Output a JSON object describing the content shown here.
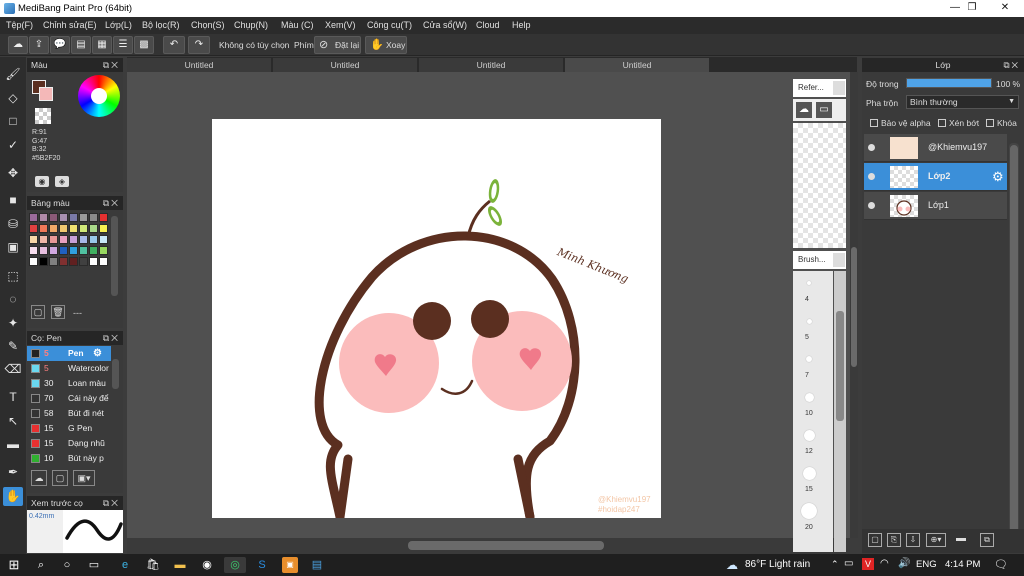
{
  "window": {
    "title": "MediBang Paint Pro (64bit)",
    "minimize": "—",
    "maximize": "❐",
    "close": "✕"
  },
  "menu": [
    "Tệp(F)",
    "Chỉnh sửa(E)",
    "Lớp(L)",
    "Bộ lọc(R)",
    "Chọn(S)",
    "Chụp(N)",
    "Màu (C)",
    "Xem(V)",
    "Công cụ(T)",
    "Cửa sổ(W)",
    "Cloud",
    "Help"
  ],
  "toolbar": {
    "option_label": "Không có tùy chọn",
    "key_label": "Phím",
    "reset_label": "Đặt lại",
    "rotate_label": "Xoay"
  },
  "tabs": [
    "Untitled",
    "Untitled",
    "Untitled",
    "Untitled"
  ],
  "color_panel": {
    "title": "Màu",
    "r": "R:91",
    "g": "G:47",
    "b": "B:32",
    "hex": "#5B2F20",
    "primary_color": "#5b2f20",
    "secondary_color": "#f4b8b8"
  },
  "palette_panel": {
    "title": "Bảng màu",
    "footer": "---",
    "swatches": [
      "#9b6b9b",
      "#b08aa8",
      "#8b5a78",
      "#a890b0",
      "#7a7aa8",
      "#9a9a9a",
      "#8a8a8a",
      "#e53030",
      "#e04040",
      "#f07858",
      "#f0a868",
      "#f0c870",
      "#f0e070",
      "#d0e878",
      "#a8d888",
      "#f8f050",
      "#f8d8a8",
      "#f0b8a8",
      "#e89898",
      "#e8a0c0",
      "#c8a0d8",
      "#a8b8e8",
      "#98c8e8",
      "#c8e8f8",
      "#f8e0f0",
      "#e8c0e0",
      "#d0a8e0",
      "#2060c0",
      "#30a0e0",
      "#50c0a0",
      "#40b060",
      "#98d860",
      "#ffffff",
      "#000000",
      "#808080",
      "#803030",
      "#602020",
      "#404040",
      "#ffffff",
      "#ffffff"
    ]
  },
  "brush_panel": {
    "title": "Cọ: Pen",
    "brushes": [
      {
        "size": "5",
        "name": "Pen",
        "color": "#222222"
      },
      {
        "size": "5",
        "name": "Watercolor",
        "color": "#6ad8f0"
      },
      {
        "size": "30",
        "name": "Loan màu",
        "color": "#6ad8f0"
      },
      {
        "size": "70",
        "name": "Cái này để",
        "color": "#333333"
      },
      {
        "size": "58",
        "name": "Bút đi nét",
        "color": "#333333"
      },
      {
        "size": "15",
        "name": "G Pen",
        "color": "#e83030"
      },
      {
        "size": "15",
        "name": "Dạng nhũ",
        "color": "#e83030"
      },
      {
        "size": "10",
        "name": "Bút này p",
        "color": "#30b030"
      }
    ]
  },
  "preview_panel": {
    "title": "Xem trước cọ",
    "size": "0.42mm"
  },
  "reference_panel": {
    "title": "Refer..."
  },
  "brush_size_panel": {
    "title": "Brush...",
    "sizes": [
      "4",
      "5",
      "7",
      "10",
      "12",
      "15",
      "20"
    ]
  },
  "layer_panel": {
    "title": "Lớp",
    "opacity_label": "Độ trong",
    "opacity_value": "100 %",
    "opacity": 1.0,
    "blend_label": "Pha trộn",
    "blend_value": "Bình thường",
    "protect_alpha": "Bảo vệ alpha",
    "clipping": "Xén bớt",
    "lock": "Khóa",
    "layers": [
      {
        "name": "@Khiemvu197",
        "selected": false
      },
      {
        "name": "Lớp2",
        "selected": true
      },
      {
        "name": "Lớp1",
        "selected": false
      }
    ]
  },
  "canvas": {
    "signature": "Minh Khương",
    "watermark_1": "@Khiemvu197",
    "watermark_2": "#hoidap247"
  },
  "taskbar": {
    "weather": "86°F  Light rain",
    "language": "ENG",
    "time": "4:14 PM"
  }
}
